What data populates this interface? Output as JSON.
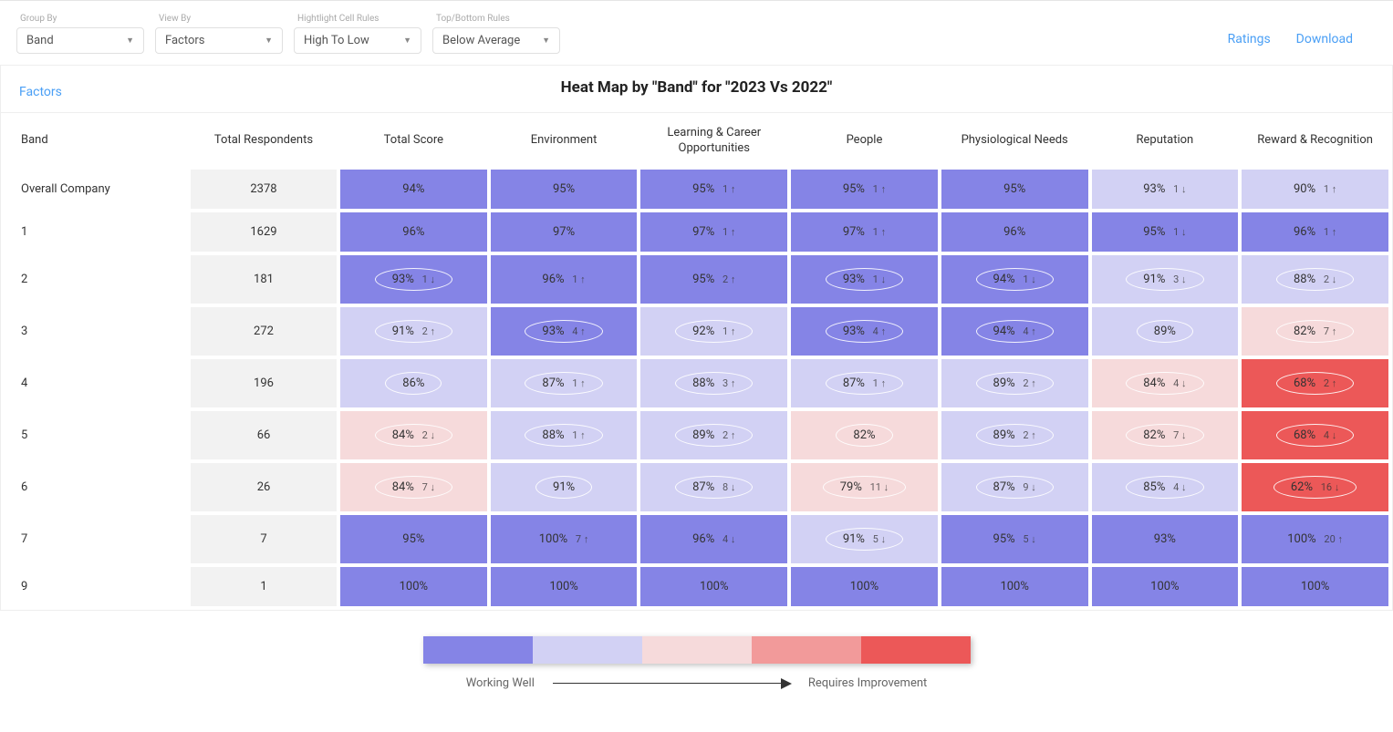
{
  "filters": {
    "group_by": {
      "label": "Group By",
      "value": "Band"
    },
    "view_by": {
      "label": "View By",
      "value": "Factors"
    },
    "highlight": {
      "label": "Hightlight Cell Rules",
      "value": "High To Low"
    },
    "top_bottom": {
      "label": "Top/Bottom Rules",
      "value": "Below Average"
    }
  },
  "top_links": {
    "ratings": "Ratings",
    "download": "Download"
  },
  "panel": {
    "sidelabel": "Factors",
    "title": "Heat Map by \"Band\" for \"2023 Vs 2022\""
  },
  "columns": [
    "Band",
    "Total Respondents",
    "Total Score",
    "Environment",
    "Learning & Career Opportunities",
    "People",
    "Physiological Needs",
    "Reputation",
    "Reward & Recognition"
  ],
  "legend": {
    "left": "Working Well",
    "right": "Requires Improvement"
  },
  "chart_data": {
    "type": "heatmap",
    "title": "Heat Map by \"Band\" for \"2023 Vs 2022\"",
    "xlabel": "",
    "ylabel": "Band",
    "row_header": "Band",
    "respondent_header": "Total Respondents",
    "metrics": [
      "Total Score",
      "Environment",
      "Learning & Career Opportunities",
      "People",
      "Physiological Needs",
      "Reputation",
      "Reward & Recognition"
    ],
    "color_scale": [
      "#8584e6",
      "#d2d1f4",
      "#f6dadb",
      "#f29a9a",
      "#ec5858"
    ],
    "color_scale_labels": [
      "Working Well",
      "Requires Improvement"
    ],
    "rows": [
      {
        "band": "Overall Company",
        "respondents": 2378,
        "cells": [
          {
            "pct": 94,
            "delta": null,
            "dir": null,
            "lvl": 0,
            "circled": false
          },
          {
            "pct": 95,
            "delta": null,
            "dir": null,
            "lvl": 0,
            "circled": false
          },
          {
            "pct": 95,
            "delta": 1,
            "dir": "up",
            "lvl": 0,
            "circled": false
          },
          {
            "pct": 95,
            "delta": 1,
            "dir": "up",
            "lvl": 0,
            "circled": false
          },
          {
            "pct": 95,
            "delta": null,
            "dir": null,
            "lvl": 0,
            "circled": false
          },
          {
            "pct": 93,
            "delta": 1,
            "dir": "down",
            "lvl": 1,
            "circled": false
          },
          {
            "pct": 90,
            "delta": 1,
            "dir": "up",
            "lvl": 1,
            "circled": false
          }
        ]
      },
      {
        "band": "1",
        "respondents": 1629,
        "cells": [
          {
            "pct": 96,
            "delta": null,
            "dir": null,
            "lvl": 0,
            "circled": false
          },
          {
            "pct": 97,
            "delta": null,
            "dir": null,
            "lvl": 0,
            "circled": false
          },
          {
            "pct": 97,
            "delta": 1,
            "dir": "up",
            "lvl": 0,
            "circled": false
          },
          {
            "pct": 97,
            "delta": 1,
            "dir": "up",
            "lvl": 0,
            "circled": false
          },
          {
            "pct": 96,
            "delta": null,
            "dir": null,
            "lvl": 0,
            "circled": false
          },
          {
            "pct": 95,
            "delta": 1,
            "dir": "down",
            "lvl": 0,
            "circled": false
          },
          {
            "pct": 96,
            "delta": 1,
            "dir": "up",
            "lvl": 0,
            "circled": false
          }
        ]
      },
      {
        "band": "2",
        "respondents": 181,
        "cells": [
          {
            "pct": 93,
            "delta": 1,
            "dir": "down",
            "lvl": 0,
            "circled": true
          },
          {
            "pct": 96,
            "delta": 1,
            "dir": "up",
            "lvl": 0,
            "circled": false
          },
          {
            "pct": 95,
            "delta": 2,
            "dir": "up",
            "lvl": 0,
            "circled": false
          },
          {
            "pct": 93,
            "delta": 1,
            "dir": "down",
            "lvl": 0,
            "circled": true
          },
          {
            "pct": 94,
            "delta": 1,
            "dir": "down",
            "lvl": 0,
            "circled": true
          },
          {
            "pct": 91,
            "delta": 3,
            "dir": "down",
            "lvl": 1,
            "circled": true
          },
          {
            "pct": 88,
            "delta": 2,
            "dir": "down",
            "lvl": 1,
            "circled": true
          }
        ]
      },
      {
        "band": "3",
        "respondents": 272,
        "cells": [
          {
            "pct": 91,
            "delta": 2,
            "dir": "up",
            "lvl": 1,
            "circled": true
          },
          {
            "pct": 93,
            "delta": 4,
            "dir": "up",
            "lvl": 0,
            "circled": true
          },
          {
            "pct": 92,
            "delta": 1,
            "dir": "up",
            "lvl": 1,
            "circled": true
          },
          {
            "pct": 93,
            "delta": 4,
            "dir": "up",
            "lvl": 0,
            "circled": true
          },
          {
            "pct": 94,
            "delta": 4,
            "dir": "up",
            "lvl": 0,
            "circled": true
          },
          {
            "pct": 89,
            "delta": null,
            "dir": null,
            "lvl": 1,
            "circled": true
          },
          {
            "pct": 82,
            "delta": 7,
            "dir": "up",
            "lvl": 2,
            "circled": true
          }
        ]
      },
      {
        "band": "4",
        "respondents": 196,
        "cells": [
          {
            "pct": 86,
            "delta": null,
            "dir": null,
            "lvl": 1,
            "circled": true
          },
          {
            "pct": 87,
            "delta": 1,
            "dir": "up",
            "lvl": 1,
            "circled": true
          },
          {
            "pct": 88,
            "delta": 3,
            "dir": "up",
            "lvl": 1,
            "circled": true
          },
          {
            "pct": 87,
            "delta": 1,
            "dir": "up",
            "lvl": 1,
            "circled": true
          },
          {
            "pct": 89,
            "delta": 2,
            "dir": "up",
            "lvl": 1,
            "circled": true
          },
          {
            "pct": 84,
            "delta": 4,
            "dir": "down",
            "lvl": 2,
            "circled": true
          },
          {
            "pct": 68,
            "delta": 2,
            "dir": "up",
            "lvl": 4,
            "circled": true
          }
        ]
      },
      {
        "band": "5",
        "respondents": 66,
        "cells": [
          {
            "pct": 84,
            "delta": 2,
            "dir": "down",
            "lvl": 2,
            "circled": true
          },
          {
            "pct": 88,
            "delta": 1,
            "dir": "up",
            "lvl": 1,
            "circled": true
          },
          {
            "pct": 89,
            "delta": 2,
            "dir": "up",
            "lvl": 1,
            "circled": true
          },
          {
            "pct": 82,
            "delta": null,
            "dir": null,
            "lvl": 2,
            "circled": true
          },
          {
            "pct": 89,
            "delta": 2,
            "dir": "up",
            "lvl": 1,
            "circled": true
          },
          {
            "pct": 82,
            "delta": 7,
            "dir": "down",
            "lvl": 2,
            "circled": true
          },
          {
            "pct": 68,
            "delta": 4,
            "dir": "down",
            "lvl": 4,
            "circled": true
          }
        ]
      },
      {
        "band": "6",
        "respondents": 26,
        "cells": [
          {
            "pct": 84,
            "delta": 7,
            "dir": "down",
            "lvl": 2,
            "circled": true
          },
          {
            "pct": 91,
            "delta": null,
            "dir": null,
            "lvl": 1,
            "circled": true
          },
          {
            "pct": 87,
            "delta": 8,
            "dir": "down",
            "lvl": 1,
            "circled": true
          },
          {
            "pct": 79,
            "delta": 11,
            "dir": "down",
            "lvl": 2,
            "circled": true
          },
          {
            "pct": 87,
            "delta": 9,
            "dir": "down",
            "lvl": 1,
            "circled": true
          },
          {
            "pct": 85,
            "delta": 4,
            "dir": "down",
            "lvl": 1,
            "circled": true
          },
          {
            "pct": 62,
            "delta": 16,
            "dir": "down",
            "lvl": 4,
            "circled": true
          }
        ]
      },
      {
        "band": "7",
        "respondents": 7,
        "cells": [
          {
            "pct": 95,
            "delta": null,
            "dir": null,
            "lvl": 0,
            "circled": false
          },
          {
            "pct": 100,
            "delta": 7,
            "dir": "up",
            "lvl": 0,
            "circled": false
          },
          {
            "pct": 96,
            "delta": 4,
            "dir": "down",
            "lvl": 0,
            "circled": false
          },
          {
            "pct": 91,
            "delta": 5,
            "dir": "down",
            "lvl": 1,
            "circled": true
          },
          {
            "pct": 95,
            "delta": 5,
            "dir": "down",
            "lvl": 0,
            "circled": false
          },
          {
            "pct": 93,
            "delta": null,
            "dir": null,
            "lvl": 0,
            "circled": false
          },
          {
            "pct": 100,
            "delta": 20,
            "dir": "up",
            "lvl": 0,
            "circled": false
          }
        ]
      },
      {
        "band": "9",
        "respondents": 1,
        "cells": [
          {
            "pct": 100,
            "delta": null,
            "dir": null,
            "lvl": 0,
            "circled": false
          },
          {
            "pct": 100,
            "delta": null,
            "dir": null,
            "lvl": 0,
            "circled": false
          },
          {
            "pct": 100,
            "delta": null,
            "dir": null,
            "lvl": 0,
            "circled": false
          },
          {
            "pct": 100,
            "delta": null,
            "dir": null,
            "lvl": 0,
            "circled": false
          },
          {
            "pct": 100,
            "delta": null,
            "dir": null,
            "lvl": 0,
            "circled": false
          },
          {
            "pct": 100,
            "delta": null,
            "dir": null,
            "lvl": 0,
            "circled": false
          },
          {
            "pct": 100,
            "delta": null,
            "dir": null,
            "lvl": 0,
            "circled": false
          }
        ]
      }
    ]
  }
}
